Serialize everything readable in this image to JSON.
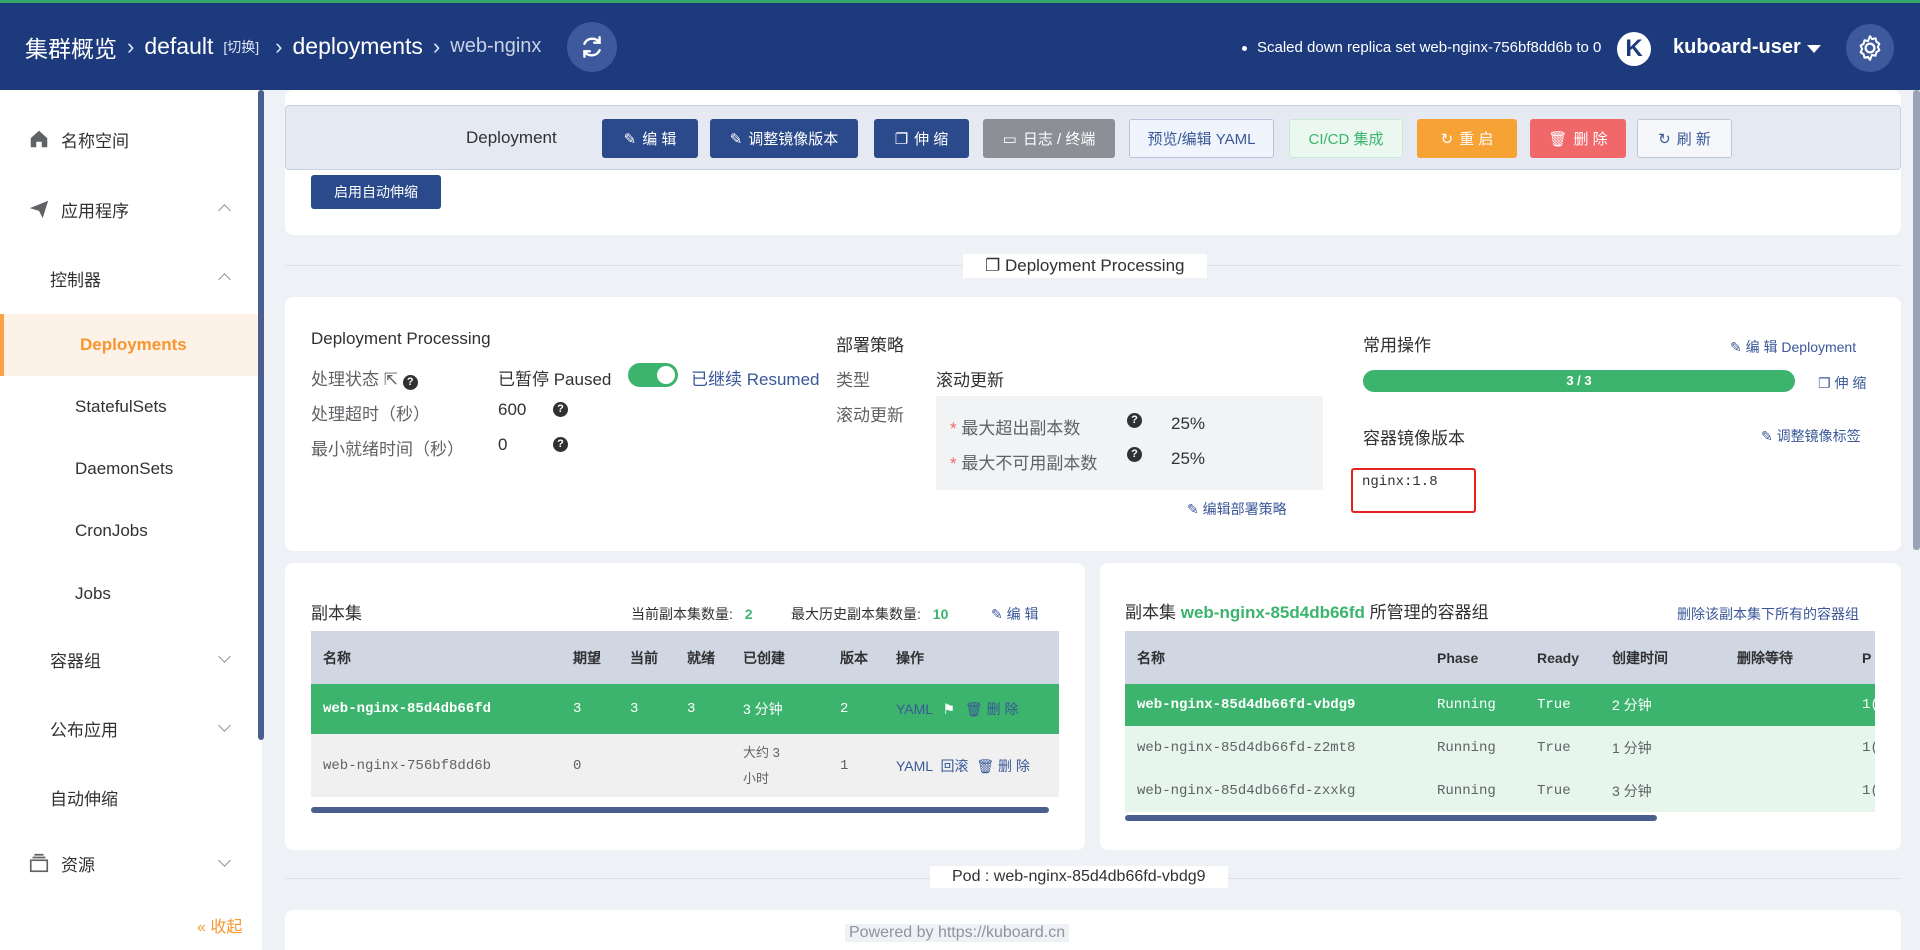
{
  "header": {
    "crumb_cluster": "集群概览",
    "crumb_namespace": "default",
    "crumb_switch": "[切换]",
    "crumb_kind": "deployments",
    "crumb_name": "web-nginx",
    "event_message": "Scaled down replica set web-nginx-756bf8dd6b to 0",
    "avatar_letter": "K",
    "username": "kuboard-user"
  },
  "sidebar": {
    "items": [
      {
        "label": "名称空间",
        "icon": "home-icon"
      },
      {
        "label": "应用程序",
        "icon": "send-icon"
      },
      {
        "label": "控制器"
      },
      {
        "label": "Deployments"
      },
      {
        "label": "StatefulSets"
      },
      {
        "label": "DaemonSets"
      },
      {
        "label": "CronJobs"
      },
      {
        "label": "Jobs"
      },
      {
        "label": "容器组"
      },
      {
        "label": "公布应用"
      },
      {
        "label": "自动伸缩"
      },
      {
        "label": "资源",
        "icon": "box-icon"
      }
    ],
    "collapse_label": "« 收起"
  },
  "toolbar": {
    "title": "Deployment",
    "edit": "编 辑",
    "adjust_image": "调整镜像版本",
    "scale": "伸 缩",
    "logs": "日志 / 终端",
    "preview_yaml": "预览/编辑 YAML",
    "cicd": "CI/CD 集成",
    "restart": "重 启",
    "delete": "删 除",
    "refresh": "刷 新",
    "enable_autoscale": "启用自动伸缩"
  },
  "processing": {
    "section_label": "Deployment Processing",
    "title": "Deployment Processing",
    "status_label": "处理状态",
    "status_paused": "已暂停 Paused",
    "status_resumed": "已继续 Resumed",
    "timeout_label": "处理超时（秒）",
    "timeout_value": "600",
    "min_ready_label": "最小就绪时间（秒）",
    "min_ready_value": "0"
  },
  "strategy": {
    "title": "部署策略",
    "type_label": "类型",
    "type_value": "滚动更新",
    "rolling_label": "滚动更新",
    "max_surge_label": "最大超出副本数",
    "max_surge_value": "25%",
    "max_unavailable_label": "最大不可用副本数",
    "max_unavailable_value": "25%",
    "edit_link": "编辑部署策略"
  },
  "ops": {
    "title": "常用操作",
    "edit_link": "编 辑 Deployment",
    "progress_text": "3 / 3",
    "progress_fraction": 1.0,
    "scale_link": "伸 缩",
    "image_title": "容器镜像版本",
    "adjust_link": "调整镜像标签",
    "image_value": "nginx:1.8"
  },
  "replicasets": {
    "title": "副本集",
    "current_label": "当前副本集数量:",
    "current_value": "2",
    "max_history_label": "最大历史副本集数量:",
    "max_history_value": "10",
    "edit_link": "编 辑",
    "columns": [
      "名称",
      "期望",
      "当前",
      "就绪",
      "已创建",
      "版本",
      "操作"
    ],
    "rows": [
      {
        "name": "web-nginx-85d4db66fd",
        "desired": "3",
        "current": "3",
        "ready": "3",
        "created": "3 分钟",
        "version": "2",
        "yaml": "YAML",
        "delete": "删 除"
      },
      {
        "name": "web-nginx-756bf8dd6b",
        "desired": "0",
        "current": "",
        "ready": "",
        "created_1": "大约 3",
        "created_2": "小时",
        "version": "1",
        "yaml": "YAML",
        "rollback": "回滚",
        "delete": "删 除"
      }
    ]
  },
  "pods": {
    "title_prefix": "副本集",
    "title_rs": "web-nginx-85d4db66fd",
    "title_suffix": "所管理的容器组",
    "delete_all_link": "删除该副本集下所有的容器组",
    "columns": [
      "名称",
      "Phase",
      "Ready",
      "创建时间",
      "删除等待",
      "P"
    ],
    "rows": [
      {
        "name": "web-nginx-85d4db66fd-vbdg9",
        "phase": "Running",
        "ready": "True",
        "created": "2 分钟",
        "trunc": "1("
      },
      {
        "name": "web-nginx-85d4db66fd-z2mt8",
        "phase": "Running",
        "ready": "True",
        "created": "1 分钟",
        "trunc": "1("
      },
      {
        "name": "web-nginx-85d4db66fd-zxxkg",
        "phase": "Running",
        "ready": "True",
        "created": "3 分钟",
        "trunc": "1("
      }
    ]
  },
  "pod_section_label": "Pod : web-nginx-85d4db66fd-vbdg9",
  "footer": "Powered by https://kuboard.cn",
  "colors": {
    "header": "#1d3a7d",
    "accent_green": "#3cb46e",
    "accent_orange": "#f7962f",
    "danger": "#f0686a"
  }
}
